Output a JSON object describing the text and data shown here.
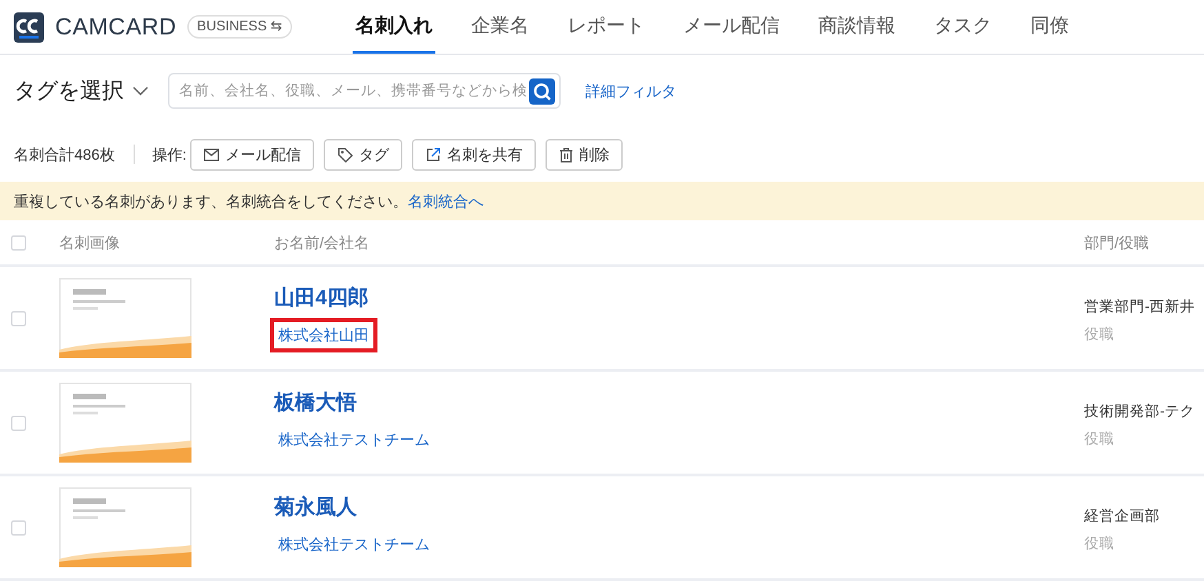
{
  "header": {
    "logo_text": "CAMCARD",
    "edition": "BUSINESS ⇆",
    "tabs": [
      {
        "label": "名刺入れ",
        "selected": true
      },
      {
        "label": "企業名",
        "selected": false
      },
      {
        "label": "レポート",
        "selected": false
      },
      {
        "label": "メール配信",
        "selected": false
      },
      {
        "label": "商談情報",
        "selected": false
      },
      {
        "label": "タスク",
        "selected": false
      },
      {
        "label": "同僚",
        "selected": false
      }
    ]
  },
  "filter": {
    "tag_select": "タグを選択",
    "search": {
      "placeholder": "名前、会社名、役職、メール、携帯番号などから検"
    },
    "advanced_filter": "詳細フィルタ"
  },
  "actions": {
    "total": "名刺合計486枚",
    "label": "操作:",
    "buttons": [
      {
        "kind": "mail",
        "label": "メール配信"
      },
      {
        "kind": "tag",
        "label": "タグ"
      },
      {
        "kind": "share",
        "label": "名刺を共有"
      },
      {
        "kind": "delete",
        "label": "削除"
      }
    ]
  },
  "notice": {
    "text": "重複している名刺があります、名刺統合をしてください。",
    "link": "名刺統合へ"
  },
  "table": {
    "select_all": {
      "checked": false
    },
    "columns": [
      "名刺画像",
      "お名前/会社名",
      "部門/役職"
    ],
    "rows": [
      {
        "checked": false,
        "name": "山田4四郎",
        "company": "株式会社山田",
        "company_highlighted": true,
        "department": "営業部門-西新井",
        "title": "役職"
      },
      {
        "checked": false,
        "name": "板橋大悟",
        "company": "株式会社テストチーム",
        "company_highlighted": false,
        "department": "技術開発部-テク",
        "title": "役職"
      },
      {
        "checked": false,
        "name": "菊永風人",
        "company": "株式会社テストチーム",
        "company_highlighted": false,
        "department": "経営企画部",
        "title": "役職"
      }
    ]
  }
}
